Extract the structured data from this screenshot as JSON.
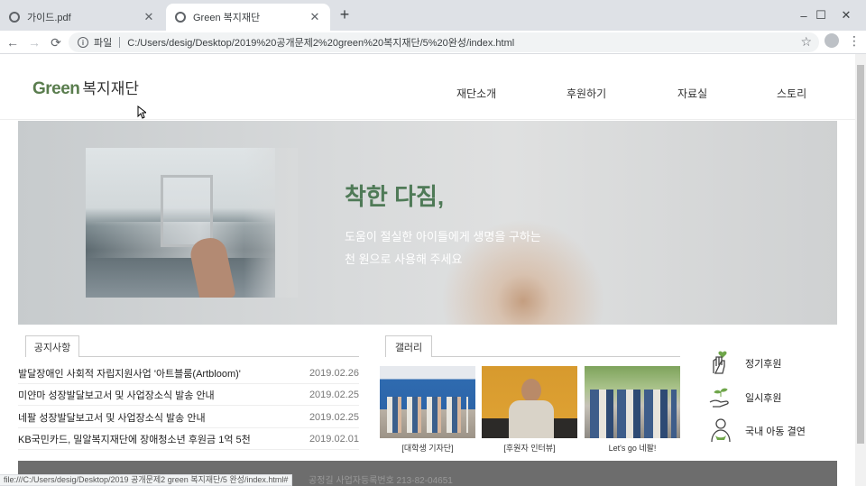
{
  "browser": {
    "tabs": [
      {
        "label": "가이드.pdf",
        "active": false
      },
      {
        "label": "Green 복지재단",
        "active": true
      }
    ],
    "new_tab": "+",
    "window_controls": {
      "minimize": "–",
      "maximize": "☐",
      "close": "✕"
    },
    "nav": {
      "back": "←",
      "forward": "→",
      "reload": "⟳"
    },
    "address": {
      "scheme_label": "파일",
      "url": "C:/Users/desig/Desktop/2019%20공개문제2%20green%20복지재단/5%20완성/index.html"
    },
    "status_url": "file:///C:/Users/desig/Desktop/2019 공개문제2 green 복지재단/5 완성/index.html#"
  },
  "site": {
    "logo": {
      "brand": "Green",
      "name": "복지재단"
    },
    "nav": [
      "재단소개",
      "후원하기",
      "자료실",
      "스토리"
    ],
    "hero": {
      "title": "착한 다짐,",
      "line1": "도움이 절실한 아이들에게 생명을 구하는",
      "line2": "천 원으로 사용해 주세요"
    },
    "notice": {
      "tab_label": "공지사항",
      "items": [
        {
          "title": "발달장애인 사회적 자립지원사업 '아트블룸(Artbloom)'",
          "date": "2019.02.26"
        },
        {
          "title": "미얀마 성장발달보고서 및 사업장소식 발송 안내",
          "date": "2019.02.25"
        },
        {
          "title": "네팔 성장발달보고서 및 사업장소식 발송 안내",
          "date": "2019.02.25"
        },
        {
          "title": "KB국민카드, 밀알복지재단에 장애청소년 후원금 1억 5천",
          "date": "2019.02.01"
        }
      ]
    },
    "gallery": {
      "tab_label": "갤러리",
      "items": [
        {
          "caption": "[대학생 기자단]"
        },
        {
          "caption": "[후원자 인터뷰]"
        },
        {
          "caption": "Let's go 네팔!"
        }
      ]
    },
    "quick_links": [
      {
        "label": "정기후원",
        "icon": "hand-heart-icon"
      },
      {
        "label": "일시후원",
        "icon": "hand-sprout-icon"
      },
      {
        "label": "국내 아동 결연",
        "icon": "person-icon"
      }
    ],
    "footer": {
      "partial_text": "공정길 사업자등록번호 213-82-04651"
    },
    "colors": {
      "brand_green": "#5a7d4e",
      "hero_title": "#4f7a57",
      "footer_bg": "#6d6d6d"
    }
  }
}
